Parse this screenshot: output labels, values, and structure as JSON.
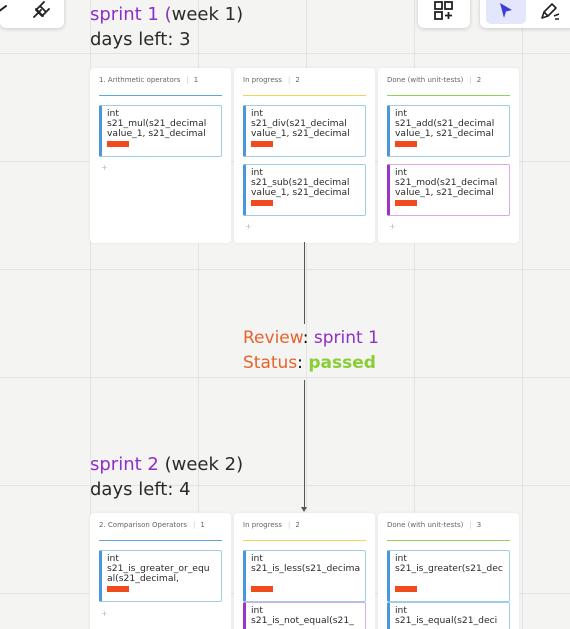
{
  "toolbar": {
    "icons": [
      "arrow-icon",
      "plugin-icon",
      "add-template-icon",
      "select-cursor-icon",
      "pen-icon"
    ]
  },
  "sprint1": {
    "name": "sprint 1",
    "paren_open": " (",
    "week": "week 1)",
    "days_left": "days left: 3"
  },
  "review": {
    "label": "Review",
    "colon": ": ",
    "sprint": "sprint 1",
    "status_label": "Status",
    "status_colon": ": ",
    "status_value": "passed"
  },
  "sprint2": {
    "name": "sprint 2",
    "paren_open": " (",
    "week": "week 2)",
    "days_left": "days left: 4"
  },
  "board1": {
    "columns": [
      {
        "title": "1. Arithmetic operators",
        "count": "1",
        "add": "+",
        "cards": [
          {
            "title": "int\ns21_mul(s21_decimal\nvalue_1, s21_decimal"
          }
        ]
      },
      {
        "title": "In progress",
        "count": "2",
        "add": "+",
        "cards": [
          {
            "title": "int\ns21_div(s21_decimal\nvalue_1, s21_decimal"
          },
          {
            "title": "int\ns21_sub(s21_decimal\nvalue_1, s21_decimal"
          }
        ]
      },
      {
        "title": "Done (with unit-tests)",
        "count": "2",
        "add": "+",
        "cards": [
          {
            "title": "int\ns21_add(s21_decimal\nvalue_1, s21_decimal"
          },
          {
            "title": "int\ns21_mod(s21_decimal\nvalue_1, s21_decimal"
          }
        ]
      }
    ]
  },
  "board2": {
    "columns": [
      {
        "title": "2. Comparison Operators",
        "count": "1",
        "add": "+",
        "cards": [
          {
            "title": "int\ns21_is_greater_or_equ\nal(s21_decimal,"
          }
        ]
      },
      {
        "title": "In progress",
        "count": "2",
        "cards": [
          {
            "title": "int\ns21_is_less(s21_decima"
          },
          {
            "title": "int\ns21_is_not_equal(s21_"
          }
        ]
      },
      {
        "title": "Done (with unit-tests)",
        "count": "3",
        "cards": [
          {
            "title": "int\ns21_is_greater(s21_dec"
          },
          {
            "title": "int\ns21_is_equal(s21_deci"
          }
        ]
      }
    ]
  }
}
